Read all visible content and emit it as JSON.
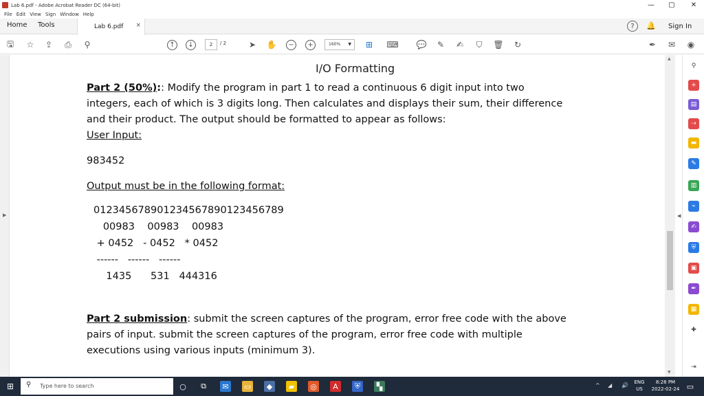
{
  "window": {
    "title": "Lab 6.pdf - Adobe Acrobat Reader DC (64-bit)",
    "minimize": "—",
    "maximize": "▢",
    "close": "✕"
  },
  "menu": [
    "File",
    "Edit",
    "View",
    "Sign",
    "Window",
    "Help"
  ],
  "tabs": {
    "home": "Home",
    "tools": "Tools",
    "document": "Lab 6.pdf",
    "close": "×",
    "help": "?",
    "signin": "Sign In"
  },
  "toolbar": {
    "page_current": "2",
    "page_total": "/ 2",
    "zoom": "160%"
  },
  "document": {
    "heading": "I/O Formatting",
    "part2_label": "Part 2 (50%)",
    "part2_text_1": ": Modify the program in part 1 to read a continuous 6 digit input into two",
    "part2_text_2": "integers, each of which is 3 digits long. Then calculates and displays their sum, their difference",
    "part2_text_3": "and their product. The output should be formatted to appear as follows:",
    "user_input_label": "User Input:",
    "user_input_value": "983452",
    "output_label": "Output must be in the following format:",
    "ruler": "012345678901234567890123456789",
    "operands_row": "   00983    00983    00983",
    "operators_row": " + 0452   - 0452   * 0452",
    "dashes_row": " ------   ------   ------",
    "results_row": "    1435      531   444316",
    "submission_label": "Part 2 submission",
    "submission_text_1": ": submit the screen captures of the program, error free code with the above",
    "submission_text_2": "pairs of input. submit the screen captures of the program, error free code with multiple",
    "submission_text_3": "executions using various inputs (minimum 3)."
  },
  "taskbar": {
    "search_placeholder": "Type here to search",
    "language_1": "ENG",
    "language_2": "US",
    "time": "8:28 PM",
    "date": "2022-02-24"
  }
}
